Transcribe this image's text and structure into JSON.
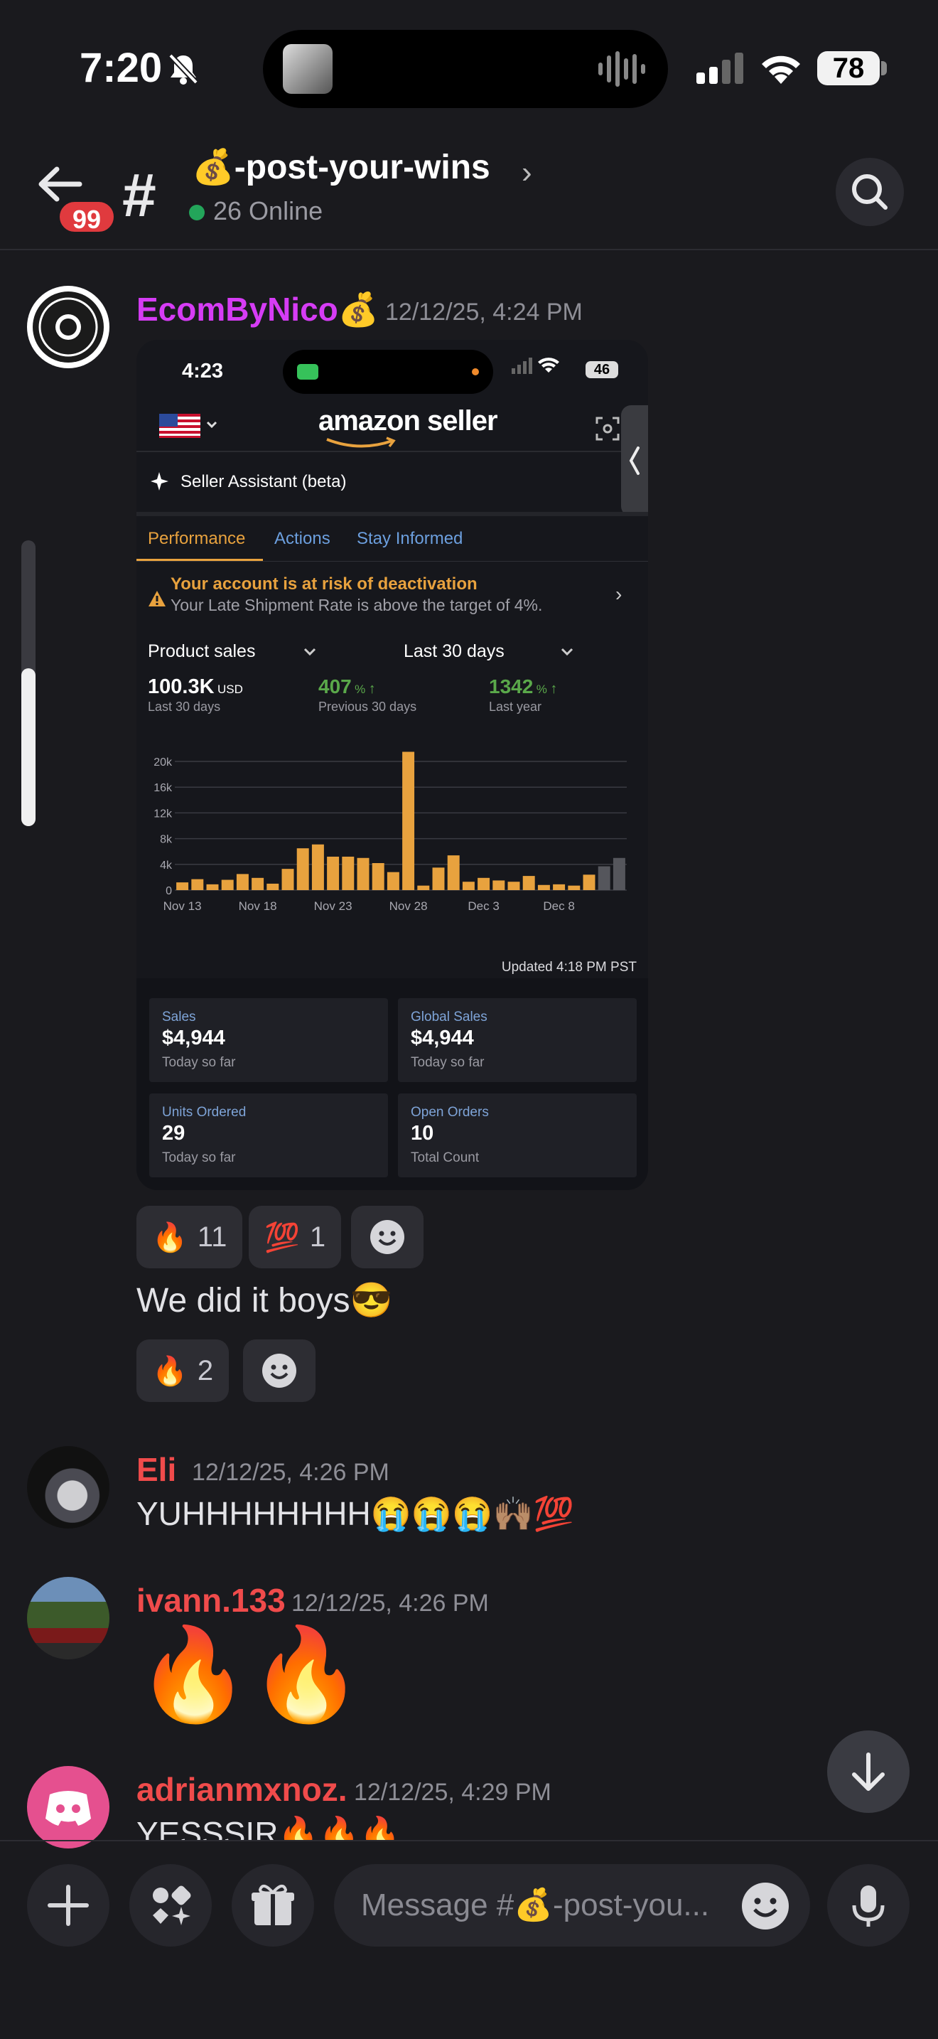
{
  "status_bar": {
    "time": "7:20",
    "battery": "78"
  },
  "header": {
    "unread_badge": "99",
    "hash": "#",
    "channel_title": "💰-post-your-wins",
    "online": "26 Online"
  },
  "messages": [
    {
      "username": "EcomByNico💰",
      "timestamp": "12/12/25, 4:24 PM",
      "attachment": {
        "status_time": "4:23",
        "status_battery": "46",
        "brand": "amazon seller",
        "assistant": "Seller Assistant (beta)",
        "tabs": [
          "Performance",
          "Actions",
          "Stay Informed"
        ],
        "alert_title": "Your account is at risk of deactivation",
        "alert_body": "Your Late Shipment Rate is above the target of 4%.",
        "metric_dropdown": "Product sales",
        "range_dropdown": "Last 30 days",
        "kpis": [
          {
            "value": "100.3K",
            "unit": "USD",
            "label": "Last 30 days"
          },
          {
            "value": "407",
            "unit": "%",
            "label": "Previous 30 days"
          },
          {
            "value": "1342",
            "unit": "%",
            "label": "Last year"
          }
        ],
        "updated": "Updated 4:18 PM PST",
        "cards": [
          {
            "label": "Sales",
            "value": "$4,944",
            "sub": "Today so far"
          },
          {
            "label": "Global Sales",
            "value": "$4,944",
            "sub": "Today so far"
          },
          {
            "label": "Units Ordered",
            "value": "29",
            "sub": "Today so far"
          },
          {
            "label": "Open Orders",
            "value": "10",
            "sub": "Total Count"
          }
        ]
      },
      "reactions": [
        {
          "emoji": "🔥",
          "count": "11"
        },
        {
          "emoji": "💯",
          "count": "1"
        }
      ],
      "followup_text": "We did it boys😎",
      "followup_reactions": [
        {
          "emoji": "🔥",
          "count": "2"
        }
      ]
    },
    {
      "username": "Eli",
      "timestamp": "12/12/25, 4:26 PM",
      "text": "YUHHHHHHHH😭😭😭🙌🏽💯"
    },
    {
      "username": "ivann.133",
      "timestamp": "12/12/25, 4:26 PM",
      "text": "🔥🔥"
    },
    {
      "username": "adrianmxnoz.",
      "timestamp": "12/12/25, 4:29 PM",
      "text": "YESSSIR🔥🔥🔥"
    }
  ],
  "composer": {
    "placeholder": "Message #💰-post-you..."
  },
  "colors": {
    "accent_purple": "#d63cf5",
    "name_red": "#f04b4b",
    "amazon_orange": "#e8a23e",
    "growth_green": "#5aa84a",
    "online_green": "#23a55a"
  },
  "chart_data": {
    "type": "bar",
    "title": "",
    "x_tick_labels": [
      "Nov 13",
      "Nov 18",
      "Nov 23",
      "Nov 28",
      "Dec 3",
      "Dec 8"
    ],
    "y_tick_labels": [
      "0",
      "4k",
      "8k",
      "12k",
      "16k",
      "20k"
    ],
    "ylim": [
      0,
      21000
    ],
    "categories": [
      "Nov 13",
      "Nov 14",
      "Nov 15",
      "Nov 16",
      "Nov 17",
      "Nov 18",
      "Nov 19",
      "Nov 20",
      "Nov 21",
      "Nov 22",
      "Nov 23",
      "Nov 24",
      "Nov 25",
      "Nov 26",
      "Nov 27",
      "Nov 28",
      "Nov 29",
      "Nov 30",
      "Dec 1",
      "Dec 2",
      "Dec 3",
      "Dec 4",
      "Dec 5",
      "Dec 6",
      "Dec 7",
      "Dec 8",
      "Dec 9",
      "Dec 10",
      "Dec 11",
      "Dec 12"
    ],
    "values": [
      1200,
      1700,
      900,
      1600,
      2500,
      1900,
      1000,
      3300,
      6500,
      7100,
      5200,
      5200,
      5000,
      4200,
      2800,
      21500,
      700,
      3500,
      5400,
      1300,
      1900,
      1500,
      1300,
      2200,
      800,
      900,
      700,
      2400,
      3700,
      5000
    ],
    "highlight_last_days": 2
  }
}
